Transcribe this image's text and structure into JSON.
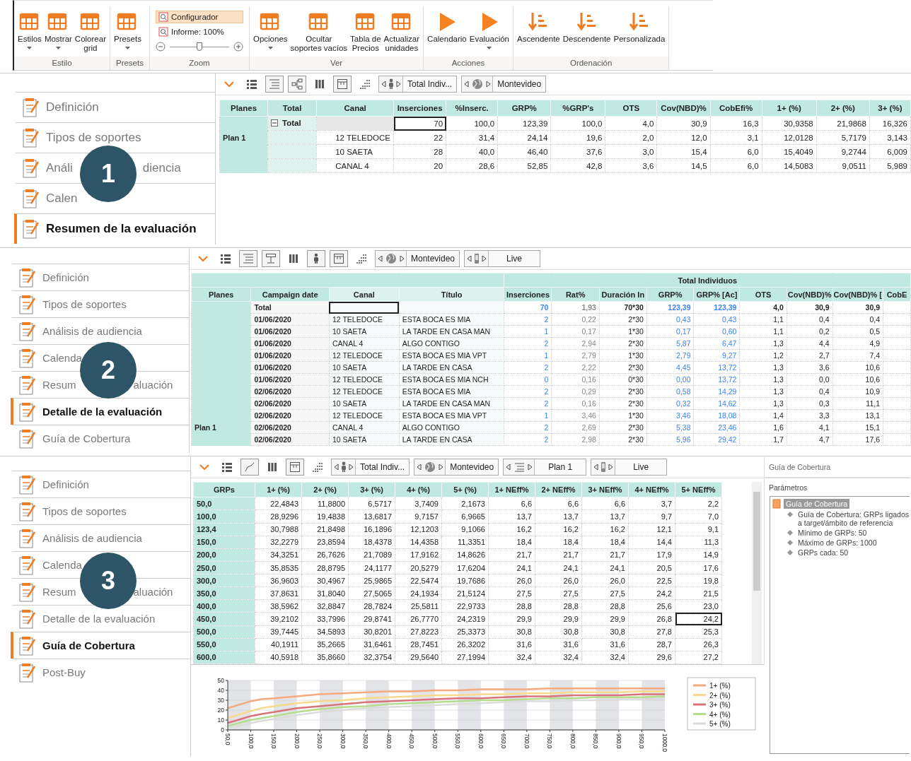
{
  "ribbon": {
    "groups": [
      {
        "kind": "grid",
        "label": "Estilo",
        "items": [
          {
            "label": "Estilos",
            "dropdown": true
          },
          {
            "label": "Mostrar",
            "dropdown": true
          },
          {
            "label": "Colorear\ngrid",
            "dropdown": false
          }
        ]
      },
      {
        "kind": "grid",
        "label": "Presets",
        "items": [
          {
            "label": "Presets",
            "dropdown": true
          }
        ]
      },
      {
        "kind": "zoom",
        "label": "Zoom",
        "buttons": [
          {
            "label": "Configurador",
            "selected": true
          },
          {
            "label": "Informe: 100%",
            "selected": false
          }
        ],
        "level": 0.5
      },
      {
        "kind": "grid",
        "label": "Ver",
        "items": [
          {
            "label": "Opciones",
            "dropdown": true
          },
          {
            "label": "Ocultar\nsoportes vacíos",
            "dropdown": false
          },
          {
            "label": "Tabla de\nPrecios",
            "dropdown": false
          },
          {
            "label": "Actualizar\nunidades",
            "dropdown": false
          }
        ]
      },
      {
        "kind": "play",
        "label": "Acciones",
        "items": [
          {
            "label": "Calendario",
            "dropdown": false
          },
          {
            "label": "Evaluación",
            "dropdown": true
          }
        ]
      },
      {
        "kind": "sort",
        "label": "Ordenación",
        "items": [
          {
            "label": "Ascendente",
            "dropdown": false
          },
          {
            "label": "Descendente",
            "dropdown": false
          },
          {
            "label": "Personalizada",
            "dropdown": false
          }
        ]
      }
    ]
  },
  "panels": [
    {
      "kind": "summary",
      "badge": "1",
      "sidebar": [
        {
          "label": "Definición",
          "selected": false
        },
        {
          "label": "Tipos de soportes",
          "selected": false
        },
        {
          "label": "Análi",
          "tail": "diencia",
          "selected": false
        },
        {
          "label": "Calen",
          "selected": false
        },
        {
          "label": "Resumen de la evaluación",
          "selected": true
        }
      ],
      "toolbar": {
        "buttons": [
          {
            "kind": "chevron",
            "pressed": false
          },
          {
            "kind": "list",
            "pressed": false
          },
          {
            "kind": "outline",
            "pressed": true
          },
          {
            "kind": "hierarchy",
            "pressed": true
          },
          {
            "kind": "columns",
            "pressed": false
          },
          {
            "kind": "frame",
            "pressed": true
          },
          {
            "kind": "dot-grid",
            "pressed": false
          }
        ],
        "selectors": [
          {
            "kind": "person",
            "label": "Total Indiv..."
          },
          {
            "kind": "globe",
            "label": "Montevideo"
          }
        ]
      },
      "table": {
        "columns": [
          "Planes",
          "Total",
          "Canal",
          "Inserciones",
          "%Inserc.",
          "GRP%",
          "%GRP's",
          "OTS",
          "Cov(NBD)%",
          "CobEfi%",
          "1+ (%)",
          "2+ (%)",
          "3+ (%)"
        ],
        "rows": [
          {
            "expanded": true,
            "focus": true,
            "cells": [
              "",
              "Total",
              "",
              "70",
              "100,0",
              "123,39",
              "100,0",
              "4,0",
              "30,9",
              "16,3",
              "30,9358",
              "21,9868",
              "16,326"
            ]
          },
          {
            "focus": false,
            "cells": [
              "Plan 1",
              "",
              "12 TELEDOCE",
              "22",
              "31,4",
              "24,14",
              "19,6",
              "2,0",
              "12,0",
              "3,1",
              "12,0128",
              "5,7179",
              "3,143"
            ]
          },
          {
            "focus": false,
            "cells": [
              "",
              "",
              "10 SAETA",
              "28",
              "40,0",
              "46,40",
              "37,6",
              "3,0",
              "15,4",
              "6,0",
              "15,4049",
              "9,2744",
              "6,009"
            ]
          },
          {
            "focus": false,
            "cells": [
              "",
              "",
              "CANAL 4",
              "20",
              "28,6",
              "52,85",
              "42,8",
              "3,6",
              "14,5",
              "6,0",
              "14,5083",
              "9,0511",
              "5,989"
            ]
          }
        ]
      }
    },
    {
      "kind": "detail",
      "badge": "2",
      "sidebar": [
        {
          "label": "Definición",
          "selected": false
        },
        {
          "label": "Tipos de soportes",
          "selected": false
        },
        {
          "label": "Análisis de audiencia",
          "selected": false
        },
        {
          "label": "Calenda",
          "selected": false
        },
        {
          "label": "Resum",
          "tail": "aluación",
          "selected": false
        },
        {
          "label": "Detalle de la evaluación",
          "selected": true
        },
        {
          "label": "Guía de Cobertura",
          "selected": false
        }
      ],
      "toolbar": {
        "buttons": [
          {
            "kind": "chevron",
            "pressed": false
          },
          {
            "kind": "list",
            "pressed": false
          },
          {
            "kind": "outline",
            "pressed": true
          },
          {
            "kind": "split",
            "pressed": true
          },
          {
            "kind": "columns",
            "pressed": false
          },
          {
            "kind": "person",
            "pressed": true
          },
          {
            "kind": "frame",
            "pressed": true
          },
          {
            "kind": "dot-grid",
            "pressed": false
          }
        ],
        "selectors": [
          {
            "kind": "globe",
            "label": "Montevideo"
          },
          {
            "kind": "phone",
            "label": "Live"
          }
        ]
      },
      "table": {
        "group_header": "Total Individuos",
        "columns": [
          {
            "label": "Planes",
            "kind": "plan"
          },
          {
            "label": "Campaign date",
            "kind": "date"
          },
          {
            "label": "Canal",
            "kind": "text"
          },
          {
            "label": "Título",
            "kind": "text"
          },
          {
            "label": "Inserciones",
            "kind": "linked"
          },
          {
            "label": "Rat%",
            "kind": "muted"
          },
          {
            "label": "Duración In",
            "kind": "number"
          },
          {
            "label": "GRP%",
            "kind": "linked"
          },
          {
            "label": "GRP% [Ac]",
            "kind": "linked"
          },
          {
            "label": "OTS",
            "kind": "number"
          },
          {
            "label": "Cov(NBD)%",
            "kind": "number"
          },
          {
            "label": "Cov(NBD)% [",
            "kind": "number"
          },
          {
            "label": "CobE",
            "kind": "number"
          }
        ],
        "rows": [
          {
            "kind": "total",
            "focus": true,
            "cells": [
              "",
              "Total",
              "",
              "",
              "70",
              "1,93",
              "70*30",
              "123,39",
              "123,39",
              "4,0",
              "30,9",
              "30,9"
            ]
          },
          {
            "kind": "item",
            "focus": false,
            "cells": [
              "",
              "01/06/2020",
              "12 TELEDOCE",
              "ESTA BOCA ES MIA",
              "2",
              "0,22",
              "2*30",
              "0,43",
              "0,43",
              "1,1",
              "0,4",
              "0,4"
            ]
          },
          {
            "kind": "item",
            "focus": false,
            "cells": [
              "",
              "01/06/2020",
              "10 SAETA",
              "LA TARDE EN CASA MAN",
              "1",
              "0,17",
              "1*30",
              "0,17",
              "0,60",
              "1,1",
              "0,2",
              "0,5"
            ]
          },
          {
            "kind": "item",
            "focus": false,
            "cells": [
              "",
              "01/06/2020",
              "CANAL 4",
              "ALGO CONTIGO",
              "2",
              "2,94",
              "2*30",
              "5,87",
              "6,47",
              "1,3",
              "4,4",
              "4,9"
            ]
          },
          {
            "kind": "item",
            "focus": false,
            "cells": [
              "",
              "01/06/2020",
              "12 TELEDOCE",
              "ESTA BOCA ES MIA VPT",
              "1",
              "2,79",
              "1*30",
              "2,79",
              "9,27",
              "1,2",
              "2,7",
              "7,4"
            ]
          },
          {
            "kind": "item",
            "focus": false,
            "cells": [
              "",
              "01/06/2020",
              "10 SAETA",
              "LA TARDE EN CASA",
              "2",
              "2,22",
              "2*30",
              "4,45",
              "13,72",
              "1,3",
              "3,6",
              "10,6"
            ]
          },
          {
            "kind": "item",
            "focus": false,
            "cells": [
              "",
              "01/06/2020",
              "12 TELEDOCE",
              "ESTA BOCA ES MIA NCH",
              "0",
              "0,16",
              "0*30",
              "0,00",
              "13,72",
              "1,3",
              "0,0",
              "10,6"
            ]
          },
          {
            "kind": "item",
            "focus": false,
            "cells": [
              "",
              "02/06/2020",
              "12 TELEDOCE",
              "ESTA BOCA ES MIA",
              "2",
              "0,29",
              "2*30",
              "0,58",
              "14,29",
              "1,3",
              "0,4",
              "10,9"
            ]
          },
          {
            "kind": "item",
            "focus": false,
            "cells": [
              "",
              "02/06/2020",
              "10 SAETA",
              "LA TARDE EN CASA MAN",
              "2",
              "0,16",
              "2*30",
              "0,32",
              "14,62",
              "1,3",
              "0,3",
              "11,1"
            ]
          },
          {
            "kind": "item",
            "focus": false,
            "cells": [
              "",
              "02/06/2020",
              "12 TELEDOCE",
              "ESTA BOCA ES MIA VPT",
              "1",
              "3,46",
              "1*30",
              "3,46",
              "18,08",
              "1,4",
              "3,3",
              "13,1"
            ]
          },
          {
            "kind": "item",
            "focus": false,
            "cells": [
              "Plan 1",
              "02/06/2020",
              "CANAL 4",
              "ALGO CONTIGO",
              "2",
              "2,69",
              "2*30",
              "5,38",
              "23,46",
              "1,6",
              "4,1",
              "15,1"
            ]
          },
          {
            "kind": "item",
            "focus": false,
            "cells": [
              "",
              "02/06/2020",
              "10 SAETA",
              "LA TARDE EN CASA",
              "2",
              "2,98",
              "2*30",
              "5,96",
              "29,42",
              "1,7",
              "4,7",
              "17,6"
            ]
          }
        ]
      }
    },
    {
      "kind": "coverage",
      "badge": "3",
      "sidebar": [
        {
          "label": "Definición",
          "selected": false
        },
        {
          "label": "Tipos de soportes",
          "selected": false
        },
        {
          "label": "Análisis de audiencia",
          "selected": false
        },
        {
          "label": "Calenda",
          "selected": false
        },
        {
          "label": "Resum",
          "tail": "aluación",
          "selected": false
        },
        {
          "label": "Detalle de la evaluación",
          "selected": false
        },
        {
          "label": "Guía de Cobertura",
          "selected": true
        },
        {
          "label": "Post-Buy",
          "selected": false
        }
      ],
      "toolbar": {
        "buttons": [
          {
            "kind": "chevron",
            "pressed": false
          },
          {
            "kind": "list",
            "pressed": false
          },
          {
            "kind": "line-chart",
            "pressed": true
          },
          {
            "kind": "columns",
            "pressed": false
          },
          {
            "kind": "frame",
            "pressed": true
          },
          {
            "kind": "dot-grid",
            "pressed": false
          }
        ],
        "selectors": [
          {
            "kind": "person",
            "label": "Total Indiv..."
          },
          {
            "kind": "globe",
            "label": "Montevideo"
          },
          {
            "kind": "outline",
            "label": "Plan 1"
          },
          {
            "kind": "phone",
            "label": "Live"
          }
        ]
      },
      "table": {
        "columns": [
          "GRPs",
          "1+ (%)",
          "2+ (%)",
          "3+ (%)",
          "4+ (%)",
          "5+ (%)",
          "1+ NEff%",
          "2+ NEff%",
          "3+ NEff%",
          "4+ NEff%",
          "5+ NEff%"
        ],
        "rows": [
          {
            "focus": false,
            "cells": [
              "50,0",
              "22,4843",
              "11,8800",
              "6,5717",
              "3,7409",
              "2,1673",
              "6,6",
              "6,6",
              "6,6",
              "3,7",
              "2,2"
            ]
          },
          {
            "focus": false,
            "cells": [
              "100,0",
              "28,9296",
              "19,4838",
              "13,6817",
              "9,7157",
              "6,9665",
              "13,7",
              "13,7",
              "13,7",
              "9,7",
              "7,0"
            ]
          },
          {
            "focus": false,
            "cells": [
              "123,4",
              "30,7988",
              "21,8498",
              "16,1896",
              "12,1203",
              "9,1066",
              "16,2",
              "16,2",
              "16,2",
              "12,1",
              "9,1"
            ]
          },
          {
            "focus": false,
            "cells": [
              "150,0",
              "32,2279",
              "23,8594",
              "18,4378",
              "14,4358",
              "11,3351",
              "18,4",
              "18,4",
              "18,4",
              "14,4",
              "11,3"
            ]
          },
          {
            "focus": false,
            "cells": [
              "200,0",
              "34,3251",
              "26,7626",
              "21,7089",
              "17,9162",
              "14,8626",
              "21,7",
              "21,7",
              "21,7",
              "17,9",
              "14,9"
            ]
          },
          {
            "focus": false,
            "cells": [
              "250,0",
              "35,8535",
              "28,8795",
              "24,1177",
              "20,5279",
              "17,6204",
              "24,1",
              "24,1",
              "24,1",
              "20,5",
              "17,6"
            ]
          },
          {
            "focus": false,
            "cells": [
              "300,0",
              "36,9603",
              "30,4967",
              "25,9865",
              "22,5474",
              "19,7686",
              "26,0",
              "26,0",
              "26,0",
              "22,5",
              "19,8"
            ]
          },
          {
            "focus": false,
            "cells": [
              "350,0",
              "37,8631",
              "31,8040",
              "27,5065",
              "24,1934",
              "21,5124",
              "27,5",
              "27,5",
              "27,5",
              "24,2",
              "21,5"
            ]
          },
          {
            "focus": false,
            "cells": [
              "400,0",
              "38,5962",
              "32,8847",
              "28,7824",
              "25,5811",
              "22,9733",
              "28,8",
              "28,8",
              "28,8",
              "25,6",
              "23,0"
            ]
          },
          {
            "focus": true,
            "cells": [
              "450,0",
              "39,2102",
              "33,7996",
              "29,8741",
              "26,7770",
              "24,2319",
              "29,9",
              "29,9",
              "29,9",
              "26,8",
              "24,2"
            ]
          },
          {
            "focus": false,
            "cells": [
              "500,0",
              "39,7445",
              "34,5893",
              "30,8201",
              "27,8223",
              "25,3373",
              "30,8",
              "30,8",
              "30,8",
              "27,8",
              "25,3"
            ]
          },
          {
            "focus": false,
            "cells": [
              "550,0",
              "40,1911",
              "35,2665",
              "31,6461",
              "28,7451",
              "26,3202",
              "31,6",
              "31,6",
              "31,6",
              "28,7",
              "26,3"
            ]
          },
          {
            "focus": false,
            "cells": [
              "600,0",
              "40,5918",
              "35,8660",
              "32,3754",
              "29,5640",
              "27,1994",
              "32,4",
              "32,4",
              "32,4",
              "29,6",
              "27,2"
            ]
          }
        ]
      },
      "chart_data": {
        "type": "line",
        "x": [
          50,
          100,
          123.4,
          150,
          200,
          250,
          300,
          350,
          400,
          450,
          500,
          550,
          600,
          650,
          700,
          750,
          800,
          850,
          900,
          950,
          1000
        ],
        "series": [
          {
            "name": "1+ (%)",
            "color": "#f5a97f",
            "values": [
              22,
              29,
              31,
              32,
              34,
              36,
              37,
              38,
              39,
              39,
              40,
              40,
              41,
              41,
              41,
              42,
              42,
              42,
              42,
              42,
              42
            ]
          },
          {
            "name": "2+ (%)",
            "color": "#f8da8c",
            "values": [
              12,
              19,
              22,
              24,
              27,
              29,
              30,
              32,
              33,
              34,
              35,
              35,
              36,
              36,
              37,
              37,
              38,
              38,
              38,
              39,
              39
            ]
          },
          {
            "name": "3+ (%)",
            "color": "#d9737b",
            "values": [
              7,
              14,
              16,
              18,
              22,
              24,
              26,
              28,
              29,
              30,
              31,
              32,
              32,
              33,
              34,
              34,
              35,
              35,
              35,
              36,
              36
            ]
          },
          {
            "name": "4+ (%)",
            "color": "#b6dc8e",
            "values": [
              4,
              10,
              12,
              14,
              18,
              21,
              23,
              24,
              26,
              27,
              28,
              29,
              30,
              30,
              31,
              32,
              32,
              33,
              33,
              33,
              34
            ]
          },
          {
            "name": "5+ (%)",
            "color": "#dcdcdc",
            "values": [
              2,
              7,
              9,
              11,
              15,
              18,
              20,
              22,
              23,
              24,
              25,
              26,
              27,
              28,
              29,
              29,
              30,
              30,
              31,
              31,
              32
            ]
          }
        ],
        "xlim": [
          50,
          1000
        ],
        "ylim": [
          0,
          50
        ],
        "yticks": [
          0,
          10,
          20,
          30,
          40,
          50
        ],
        "grid": true,
        "legend": true,
        "xticks": [
          {
            "value": 50,
            "label": "50,0"
          },
          {
            "value": 100,
            "label": "100,0"
          },
          {
            "value": 150,
            "label": "150,0"
          },
          {
            "value": 200,
            "label": "200,0"
          },
          {
            "value": 250,
            "label": "250,0"
          },
          {
            "value": 300,
            "label": "300,0"
          },
          {
            "value": 350,
            "label": "350,0"
          },
          {
            "value": 400,
            "label": "400,0"
          },
          {
            "value": 450,
            "label": "450,0"
          },
          {
            "value": 500,
            "label": "500,0"
          },
          {
            "value": 550,
            "label": "550,0"
          },
          {
            "value": 600,
            "label": "600,0"
          },
          {
            "value": 650,
            "label": "650,0"
          },
          {
            "value": 700,
            "label": "700,0"
          },
          {
            "value": 750,
            "label": "750,0"
          },
          {
            "value": 800,
            "label": "800,0"
          },
          {
            "value": 850,
            "label": "850,0"
          },
          {
            "value": 900,
            "label": "900,0"
          },
          {
            "value": 950,
            "label": "950,0"
          },
          {
            "value": 1000,
            "label": "1000,0"
          }
        ]
      },
      "side_panel": {
        "title": "Guía de Cobertura",
        "section": "Parámetros",
        "tree": {
          "label": "Guía de Cobertura",
          "selected": true,
          "children": [
            {
              "label": "Guía de Cobertura: GRPs ligados a target/ámbito de referencia"
            },
            {
              "label": "Mínimo de GRPs: 50"
            },
            {
              "label": "Máximo de GRPs: 1000"
            },
            {
              "label": "GRPs cada: 50"
            }
          ]
        }
      }
    }
  ]
}
